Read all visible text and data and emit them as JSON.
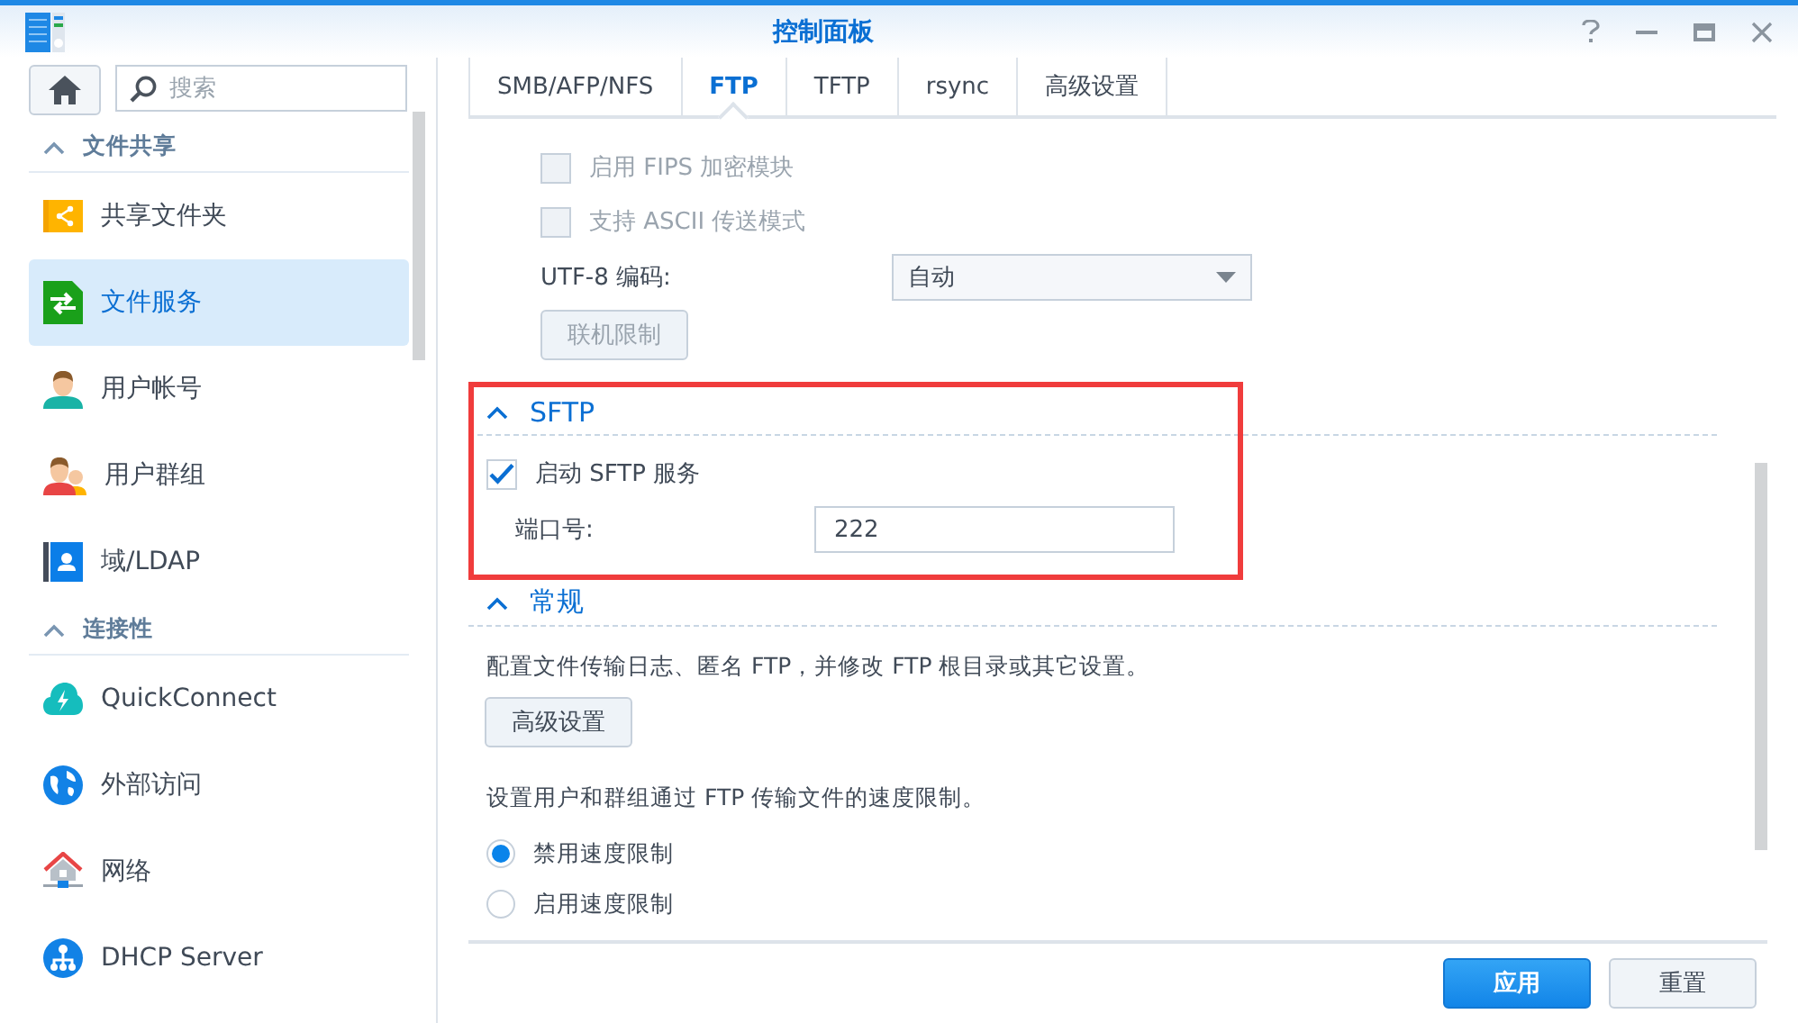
{
  "window": {
    "title": "控制面板"
  },
  "sidebar": {
    "search": {
      "placeholder": "搜索"
    },
    "sections": [
      {
        "title": "文件共享",
        "expanded": true,
        "items": [
          {
            "label": "共享文件夹",
            "kind": "folder",
            "selected": false
          },
          {
            "label": "文件服务",
            "kind": "transfer",
            "selected": true
          },
          {
            "label": "用户帐号",
            "kind": "user",
            "selected": false
          },
          {
            "label": "用户群组",
            "kind": "group",
            "selected": false
          },
          {
            "label": "域/LDAP",
            "kind": "directory",
            "selected": false
          }
        ]
      },
      {
        "title": "连接性",
        "expanded": true,
        "items": [
          {
            "label": "QuickConnect",
            "kind": "cloud",
            "selected": false
          },
          {
            "label": "外部访问",
            "kind": "globe",
            "selected": false
          },
          {
            "label": "网络",
            "kind": "network",
            "selected": false
          },
          {
            "label": "DHCP Server",
            "kind": "dhcp",
            "selected": false
          }
        ]
      }
    ]
  },
  "tabs": [
    {
      "label": "SMB/AFP/NFS",
      "selected": false
    },
    {
      "label": "FTP",
      "selected": true
    },
    {
      "label": "TFTP",
      "selected": false
    },
    {
      "label": "rsync",
      "selected": false
    },
    {
      "label": "高级设置",
      "selected": false
    }
  ],
  "ftp": {
    "options": [
      {
        "label": "启用 FIPS 加密模块",
        "checked": false,
        "disabled": true
      },
      {
        "label": "支持 ASCII 传送模式",
        "checked": false,
        "disabled": true
      }
    ],
    "encoding": {
      "label": "UTF-8 编码:",
      "value": "自动"
    },
    "limit_button": {
      "label": "联机限制",
      "disabled": true
    }
  },
  "sftp": {
    "title": "SFTP",
    "expanded": true,
    "highlighted": true,
    "enable": {
      "label": "启动 SFTP 服务",
      "checked": true
    },
    "port": {
      "label": "端口号:",
      "value": "222"
    }
  },
  "general": {
    "title": "常规",
    "expanded": true,
    "description": "配置文件传输日志、匿名 FTP，并修改 FTP 根目录或其它设置。",
    "button": "高级设置",
    "speed_description": "设置用户和群组通过 FTP 传输文件的速度限制。",
    "radios": [
      {
        "label": "禁用速度限制",
        "selected": true
      },
      {
        "label": "启用速度限制",
        "selected": false
      }
    ]
  },
  "footer": {
    "buttons": [
      {
        "label": "应用",
        "kind": "primary"
      },
      {
        "label": "重置",
        "kind": "secondary"
      }
    ]
  }
}
